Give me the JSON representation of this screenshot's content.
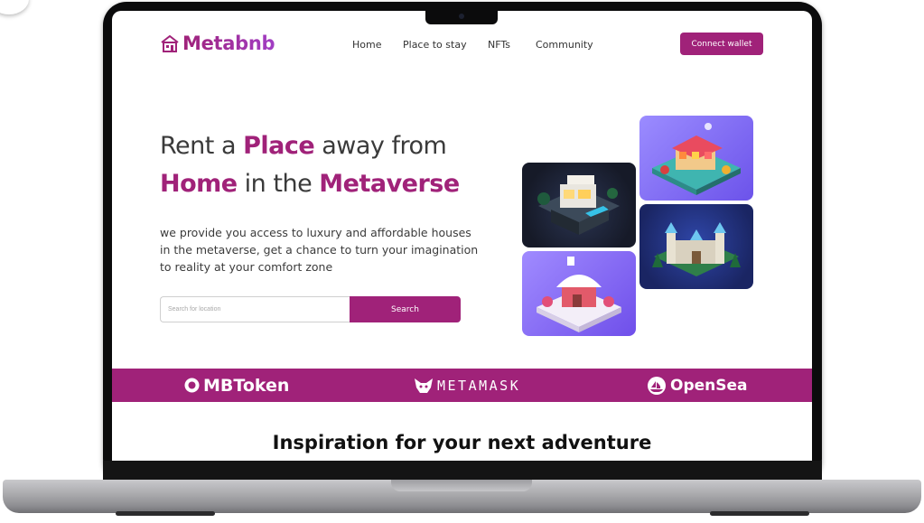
{
  "app": {
    "logo": "Metabnb",
    "nav": [
      "Home",
      "Place to stay",
      "NFTs",
      "Community"
    ],
    "connect_label": "Connect wallet"
  },
  "hero": {
    "line1": {
      "pre": "Rent a ",
      "hl": "Place",
      "post": " away from"
    },
    "line2": {
      "hl1": "Home",
      "mid": " in the ",
      "hl2": "Metaverse"
    },
    "description": "we provide you access to luxury and affordable houses in the metaverse, get a chance to turn your imagination to reality at your comfort zone",
    "search": {
      "placeholder": "Search for location",
      "button_label": "Search"
    }
  },
  "partners": [
    "MBToken",
    "METAMASK",
    "OpenSea"
  ],
  "section": {
    "title": "Inspiration for your next adventure"
  },
  "colors": {
    "brand": "#a02279",
    "tile_purple": "#7c5cf0",
    "tile_navy": "#1d2a6b"
  },
  "images": [
    "modern-villa-isometric",
    "market-stall-isometric",
    "castle-isometric",
    "snow-cabin-isometric"
  ]
}
